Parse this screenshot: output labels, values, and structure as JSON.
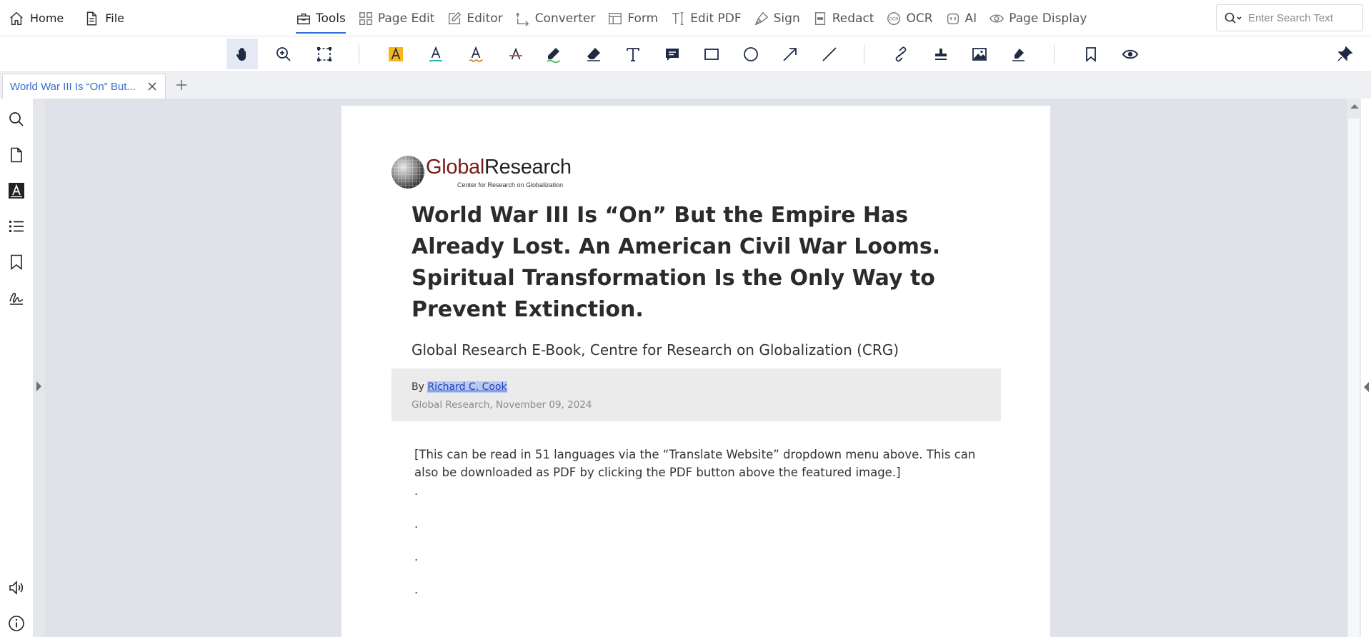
{
  "menu": {
    "home": "Home",
    "file": "File",
    "tools": "Tools",
    "page_edit": "Page Edit",
    "editor": "Editor",
    "converter": "Converter",
    "form": "Form",
    "edit_pdf": "Edit PDF",
    "sign": "Sign",
    "redact": "Redact",
    "ocr": "OCR",
    "ai": "AI",
    "page_display": "Page Display"
  },
  "search": {
    "placeholder": "Enter Search Text"
  },
  "toolbar_icons": [
    "hand-icon",
    "zoom-in-icon",
    "marquee-select-icon",
    "highlight-text-icon",
    "underline-text-icon",
    "squiggly-text-icon",
    "strikeout-text-icon",
    "pencil-icon",
    "eraser-icon",
    "text-box-icon",
    "comment-icon",
    "rectangle-icon",
    "ellipse-icon",
    "arrow-icon",
    "line-icon",
    "link-icon",
    "stamp-icon",
    "image-icon",
    "signature-icon",
    "bookmark-icon",
    "eye-icon",
    "pin-icon"
  ],
  "tabs": [
    {
      "title": "World War III Is “On” But..."
    }
  ],
  "sidebar_icons": [
    "search-icon",
    "page-thumbnails-icon",
    "text-format-icon",
    "outline-list-icon",
    "bookmark-icon",
    "signature-icon",
    "read-aloud-icon",
    "info-icon"
  ],
  "document": {
    "logo": {
      "word_a": "Global",
      "word_b": "Research",
      "tagline": "Center for Research on Globalization"
    },
    "title": "World War III Is “On” But the Empire Has Already Lost. An American Civil War Looms. Spiritual Transformation Is the Only Way to Prevent Extinction.",
    "subtitle": "Global Research E-Book, Centre for Research on Globalization (CRG)",
    "by_label": "By",
    "author": "Richard C. Cook",
    "dateline": "Global Research, November 09, 2024",
    "intro": "[This can be read in 51 languages via the “Translate Website” dropdown menu above. This can also be downloaded as PDF by clicking the PDF button above the featured image.]",
    "dots": [
      ".",
      ".",
      ".",
      "."
    ]
  },
  "colors": {
    "accent": "#2f6fd6",
    "tab_text": "#3a6fc9",
    "logo_red": "#7a1a14",
    "link": "#1b3fbf",
    "viewport_bg": "#dfe2e8"
  }
}
